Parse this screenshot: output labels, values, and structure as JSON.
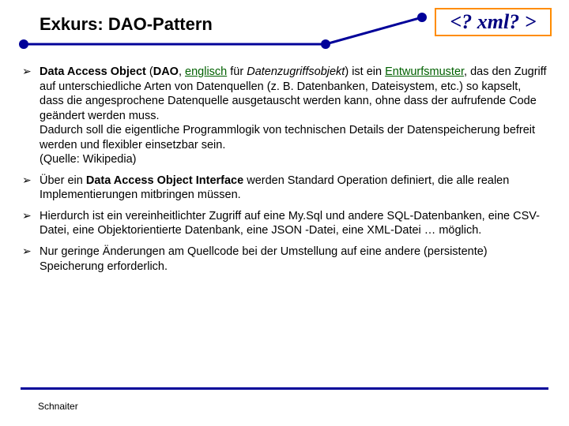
{
  "header": {
    "title": "Exkurs: DAO-Pattern",
    "xml_label": "<? xml? >"
  },
  "bullets": [
    {
      "segments": [
        {
          "t": "Data Access Object",
          "cls": "b"
        },
        {
          "t": " ("
        },
        {
          "t": "DAO",
          "cls": "b"
        },
        {
          "t": ", "
        },
        {
          "t": "englisch",
          "cls": "link"
        },
        {
          "t": " für "
        },
        {
          "t": "Datenzugriffsobjekt",
          "cls": "i"
        },
        {
          "t": ") ist ein "
        },
        {
          "t": "Entwurfsmuster",
          "cls": "link"
        },
        {
          "t": ", das den Zugriff auf unterschiedliche Arten von Datenquellen (z. B. Datenbanken, Dateisystem, etc.) so kapselt, dass die angesprochene Datenquelle ausgetauscht werden kann, ohne dass der aufrufende Code geändert werden muss."
        },
        {
          "br": true
        },
        {
          "t": "Dadurch soll die eigentliche Programmlogik von technischen Details der Datenspeicherung befreit werden und flexibler einsetzbar sein."
        },
        {
          "br": true
        },
        {
          "t": "(Quelle: Wikipedia)"
        }
      ]
    },
    {
      "segments": [
        {
          "t": "Über ein "
        },
        {
          "t": "Data Access Object Interface",
          "cls": "b"
        },
        {
          "t": " werden Standard Operation definiert, die alle realen Implementierungen mitbringen müssen."
        }
      ]
    },
    {
      "segments": [
        {
          "t": "Hierdurch ist ein vereinheitlichter Zugriff auf eine My.Sql und andere SQL-Datenbanken, eine CSV-Datei, eine Objektorientierte Datenbank, eine JSON -Datei, eine XML-Datei … möglich."
        }
      ]
    },
    {
      "segments": [
        {
          "t": "Nur geringe Änderungen am Quellcode bei der Umstellung auf eine andere (persistente) Speicherung erforderlich."
        }
      ]
    }
  ],
  "footer": {
    "author": "Schnaiter"
  }
}
